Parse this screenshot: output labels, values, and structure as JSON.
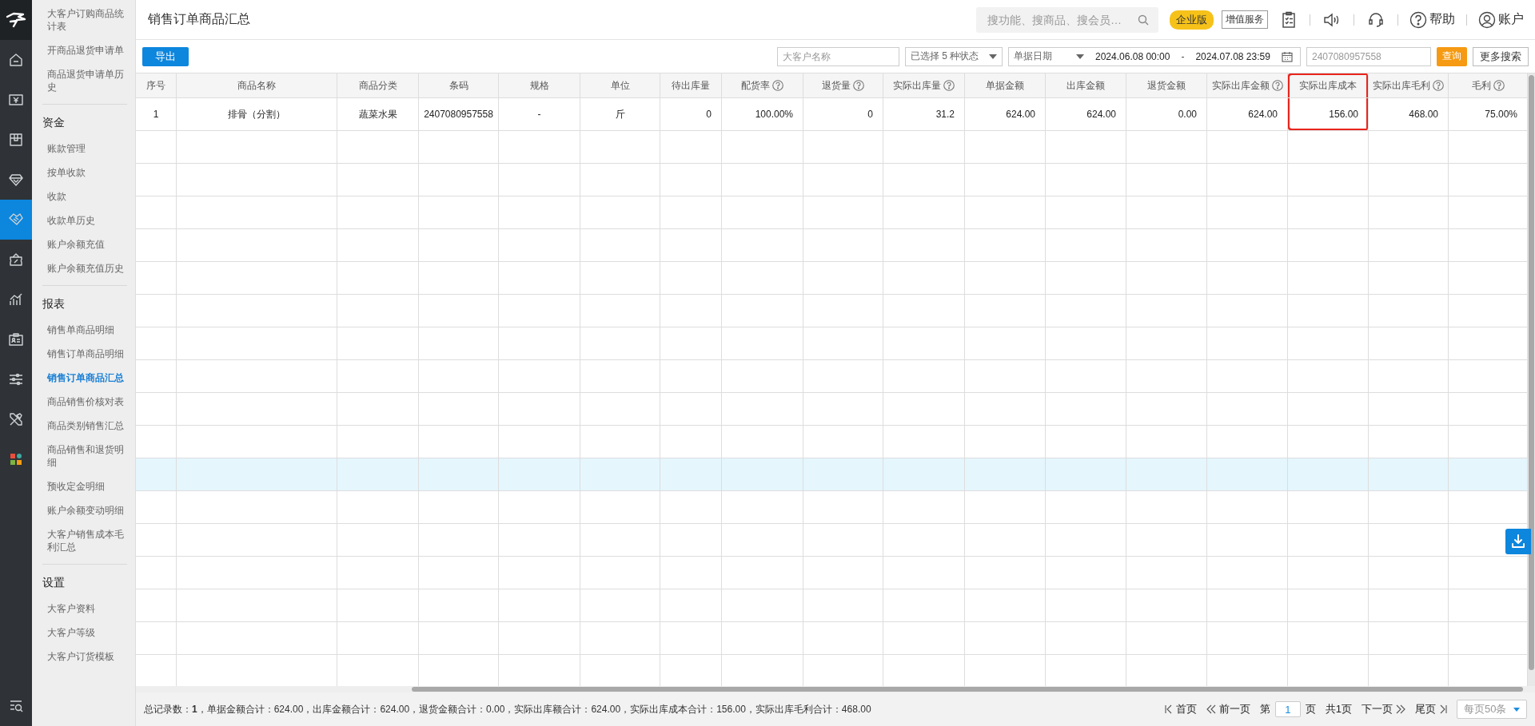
{
  "rail": {
    "items": [
      {
        "kind": "home",
        "selected": false
      },
      {
        "kind": "yen",
        "selected": false
      },
      {
        "kind": "box",
        "selected": false
      },
      {
        "kind": "diamond",
        "selected": false
      },
      {
        "kind": "handshake",
        "selected": true
      },
      {
        "kind": "ticket",
        "selected": false
      },
      {
        "kind": "chart",
        "selected": false
      },
      {
        "kind": "card",
        "selected": false
      },
      {
        "kind": "sliders",
        "selected": false
      },
      {
        "kind": "tools",
        "selected": false
      },
      {
        "kind": "apps",
        "selected": false
      }
    ]
  },
  "sidebar": {
    "sections": [
      {
        "items": [
          {
            "label": "大客户订购商品统计表",
            "selected": false
          },
          {
            "label": "开商品退货申请单",
            "selected": false
          },
          {
            "label": "商品退货申请单历史",
            "selected": false
          }
        ]
      },
      {
        "heading": "资金",
        "items": [
          {
            "label": "账款管理",
            "selected": false
          },
          {
            "label": "按单收款",
            "selected": false
          },
          {
            "label": "收款",
            "selected": false
          },
          {
            "label": "收款单历史",
            "selected": false
          },
          {
            "label": "账户余额充值",
            "selected": false
          },
          {
            "label": "账户余额充值历史",
            "selected": false
          }
        ]
      },
      {
        "heading": "报表",
        "items": [
          {
            "label": "销售单商品明细",
            "selected": false
          },
          {
            "label": "销售订单商品明细",
            "selected": false
          },
          {
            "label": "销售订单商品汇总",
            "selected": true
          },
          {
            "label": "商品销售价核对表",
            "selected": false
          },
          {
            "label": "商品类别销售汇总",
            "selected": false
          },
          {
            "label": "商品销售和退货明细",
            "selected": false
          },
          {
            "label": "预收定金明细",
            "selected": false
          },
          {
            "label": "账户余额变动明细",
            "selected": false
          },
          {
            "label": "大客户销售成本毛利汇总",
            "selected": false
          }
        ]
      },
      {
        "heading": "设置",
        "items": [
          {
            "label": "大客户资料",
            "selected": false
          },
          {
            "label": "大客户等级",
            "selected": false
          },
          {
            "label": "大客户订货模板",
            "selected": false
          }
        ]
      }
    ]
  },
  "header": {
    "title": "销售订单商品汇总",
    "search": {
      "placeholder": "搜功能、搜商品、搜会员…"
    },
    "edition_badge": "企业版",
    "value_added_button": "增值服务",
    "help_label": "帮助",
    "account_label": "账户"
  },
  "toolbar": {
    "export_button": "导出",
    "customer_field": {
      "placeholder": "大客户名称"
    },
    "status_select": "已选择 5 种状态",
    "date_type_select": "单据日期",
    "date_from": "2024.06.08 00:00",
    "date_separator": "-",
    "date_to": "2024.07.08 23:59",
    "barcode_field": {
      "placeholder": "2407080957558"
    },
    "query_button": "查询",
    "more_search_button": "更多搜索"
  },
  "table": {
    "columns": [
      {
        "label": "序号",
        "help": false,
        "highlighted": false
      },
      {
        "label": "商品名称",
        "help": false,
        "highlighted": false
      },
      {
        "label": "商品分类",
        "help": false,
        "highlighted": false
      },
      {
        "label": "条码",
        "help": false,
        "highlighted": false
      },
      {
        "label": "规格",
        "help": false,
        "highlighted": false
      },
      {
        "label": "单位",
        "help": false,
        "highlighted": false
      },
      {
        "label": "待出库量",
        "help": false,
        "highlighted": false
      },
      {
        "label": "配货率",
        "help": true,
        "highlighted": false
      },
      {
        "label": "退货量",
        "help": true,
        "highlighted": false
      },
      {
        "label": "实际出库量",
        "help": true,
        "highlighted": false
      },
      {
        "label": "单据金额",
        "help": false,
        "highlighted": false
      },
      {
        "label": "出库金额",
        "help": false,
        "highlighted": false
      },
      {
        "label": "退货金额",
        "help": false,
        "highlighted": false
      },
      {
        "label": "实际出库金额",
        "help": true,
        "highlighted": false
      },
      {
        "label": "实际出库成本",
        "help": false,
        "highlighted": true
      },
      {
        "label": "实际出库毛利",
        "help": true,
        "highlighted": false
      },
      {
        "label": "毛利",
        "help": true,
        "highlighted": false
      }
    ],
    "rows": [
      {
        "cells": [
          "1",
          "排骨（分割）",
          "蔬菜水果",
          "2407080957558",
          "-",
          "斤",
          "0",
          "100.00%",
          "0",
          "31.2",
          "624.00",
          "624.00",
          "0.00",
          "624.00",
          "156.00",
          "468.00",
          "75.00%"
        ]
      }
    ],
    "empty_rows": [
      {
        "highlighted": false
      },
      {
        "highlighted": false
      },
      {
        "highlighted": false
      },
      {
        "highlighted": false
      },
      {
        "highlighted": false
      },
      {
        "highlighted": false
      },
      {
        "highlighted": false
      },
      {
        "highlighted": false
      },
      {
        "highlighted": false
      },
      {
        "highlighted": false
      },
      {
        "highlighted": true
      },
      {
        "highlighted": false
      },
      {
        "highlighted": false
      },
      {
        "highlighted": false
      },
      {
        "highlighted": false
      },
      {
        "highlighted": false
      },
      {
        "highlighted": false
      }
    ]
  },
  "footer": {
    "summary": "总记录数：**1**，单据金额合计：624.00，出库金额合计：624.00，退货金额合计：0.00，实际出库额合计：624.00，实际出库成本合计：156.00，实际出库毛利合计：468.00",
    "pagination": {
      "first": "首页",
      "prev": "前一页",
      "page_prefix": "第",
      "page_value": "1",
      "page_suffix": "页",
      "total_pages": "共1页",
      "next": "下一页",
      "last": "尾页",
      "page_size": "每页50条"
    }
  }
}
